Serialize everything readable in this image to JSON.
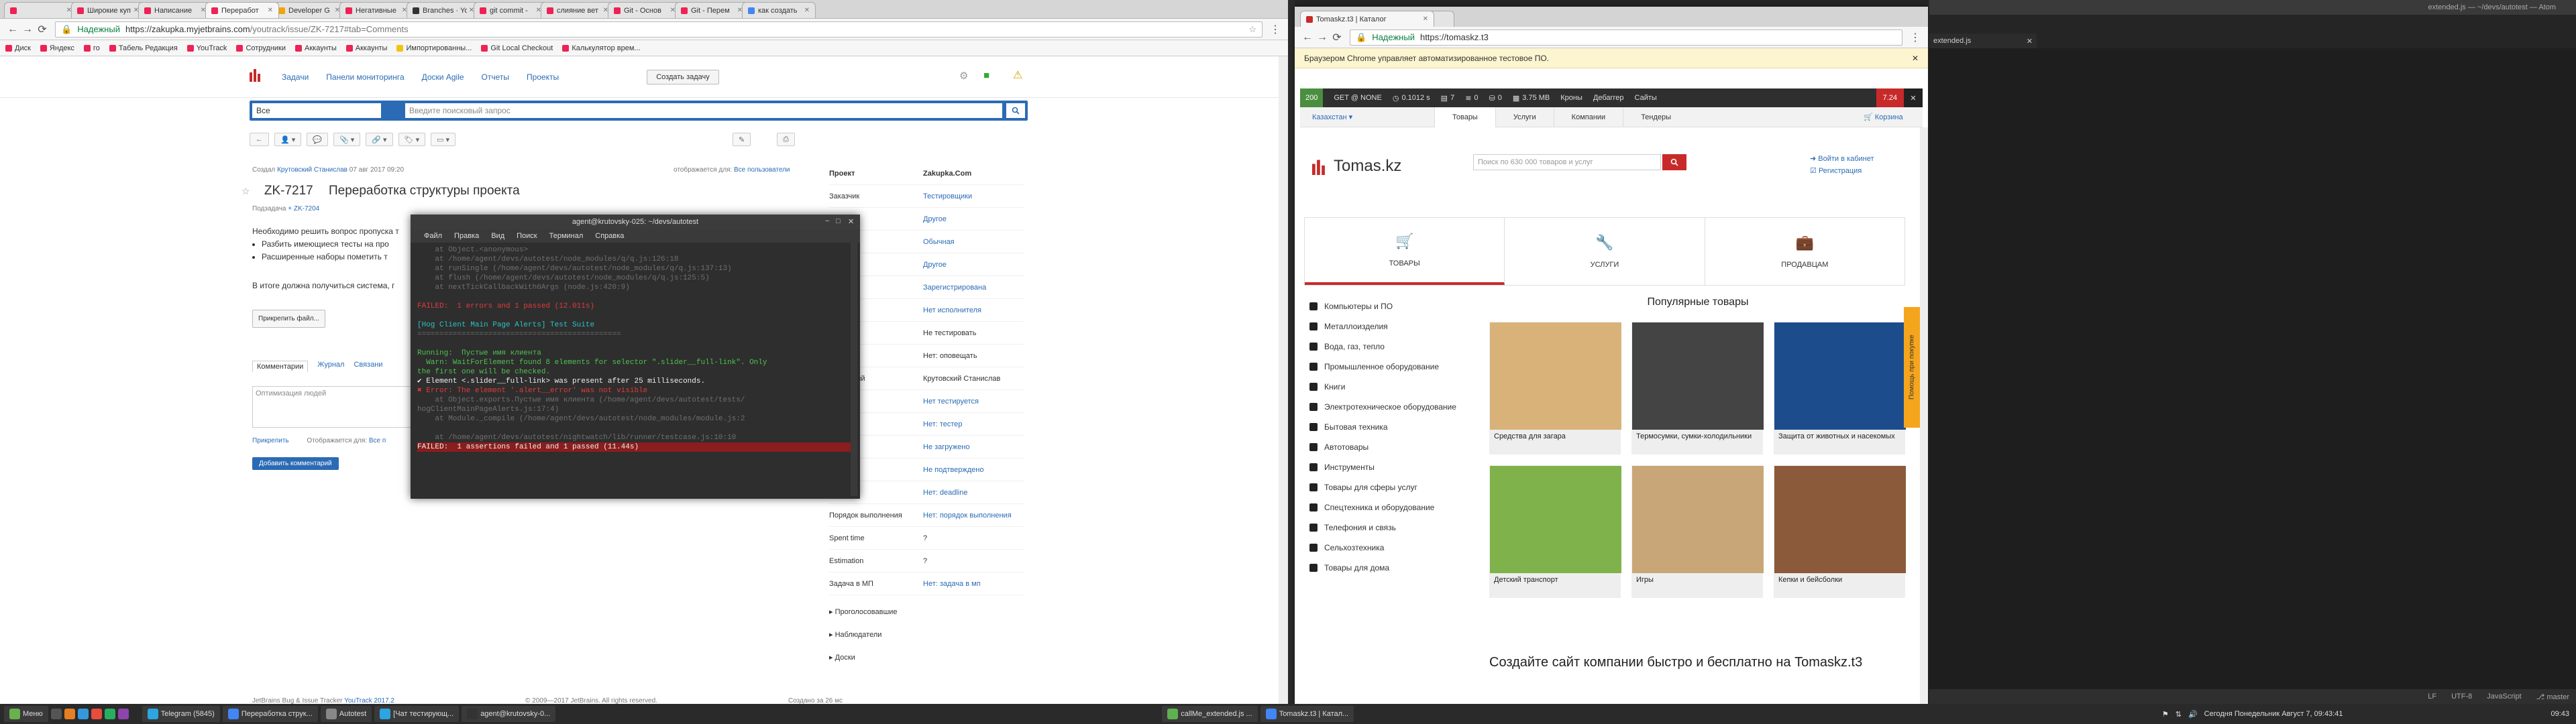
{
  "left_browser": {
    "tabs": [
      {
        "title": "",
        "color": "#e25"
      },
      {
        "title": "Широкие куп",
        "color": "#e25"
      },
      {
        "title": "Написание",
        "color": "#e25"
      },
      {
        "title": "Переработ",
        "color": "#e25"
      },
      {
        "title": "Developer G",
        "color": "#f4a300"
      },
      {
        "title": "Негативные",
        "color": "#e25"
      },
      {
        "title": "Branches · Yo",
        "color": "#333"
      },
      {
        "title": "git commit -",
        "color": "#e25"
      },
      {
        "title": "слияние вет",
        "color": "#e25"
      },
      {
        "title": "Git - Основ",
        "color": "#e25"
      },
      {
        "title": "Git - Перем",
        "color": "#e25"
      },
      {
        "title": "как создать",
        "color": "#4285f4"
      }
    ],
    "secure_label": "Надежный",
    "url_host": "https://zakupka.myjetbrains.com",
    "url_path": "/youtrack/issue/ZK-7217#tab=Comments",
    "bookmarks": [
      "Диск",
      "Яндекс",
      "го",
      "Табель Редакция",
      "YouTrack",
      "Сотрудники",
      "Аккаунты",
      "Аккаунты",
      "Импортированны...",
      "Git Local Checkout",
      "Калькулятор врем..."
    ]
  },
  "youtrack": {
    "nav": [
      "Задачи",
      "Панели мониторинга",
      "Доски Agile",
      "Отчеты",
      "Проекты"
    ],
    "create_label": "Создать задачу",
    "search_scope": "Все",
    "search_placeholder": "Введите поисковый запрос",
    "meta_prefix": "Создал",
    "meta_author": "Крутовский Станислав",
    "meta_date": "07 авг 2017 09:20",
    "meta_visible": "отображается для:",
    "meta_visible_val": "Все пользователи",
    "issue_id": "ZK-7217",
    "issue_title": "Переработка структуры проекта",
    "sub_label": "Подзадача",
    "sub_val": "ZK-7204",
    "body_intro": "Необходимо решить вопрос пропуска т",
    "body_items": [
      "Разбить имеющиеся тесты на про",
      "Расширенные наборы пометить т"
    ],
    "body_result": "В итоге должна получиться система, г",
    "attach_label": "Прикрепить файл...",
    "tab_comments": "Комментарии",
    "tab_journal": "Журнал",
    "tab_links": "Связани",
    "comment_placeholder": "Оптимизация людей",
    "attach_small": "Прикрепить",
    "visible_for": "Отображается для:",
    "visible_for_val": "Все п",
    "post_label": "Добавить комментарий",
    "footer_left": "JetBrains Bug & Issue Tracker",
    "footer_version": "YouTrack 2017.2",
    "footer_mid": "© 2009—2017 JetBrains. All rights reserved.",
    "footer_right": "Создано за 26 мс"
  },
  "sidebar": {
    "header_k": "Проект",
    "header_v": "Zakupka.Com",
    "rows": [
      {
        "k": "Заказчик",
        "v": "Тестировщики"
      },
      {
        "k": "работы",
        "v": "Другое"
      },
      {
        "k": "тет",
        "v": "Обычная"
      },
      {
        "k": "",
        "v": "Другое"
      },
      {
        "k": "ние",
        "v": "Зарегистрирована"
      },
      {
        "k": "итель",
        "v": "Нет исполнителя"
      },
      {
        "k": "вать",
        "v": "Не тестировать"
      },
      {
        "k": "щать",
        "v": "Нет: оповещать"
      },
      {
        "k": "тственный",
        "v": "Крутовский Станислав"
      },
      {
        "k": "рование",
        "v": "Нет тестируется"
      },
      {
        "k": "",
        "v": "Нет: тестер"
      },
      {
        "k": "ено",
        "v": "Не загружено"
      },
      {
        "k": "рждено",
        "v": "Не подтверждено"
      },
      {
        "k": "",
        "v": "Нет: deadline"
      },
      {
        "k": "Порядок выполнения",
        "v": "Нет: порядок выполнения"
      },
      {
        "k": "Spent time",
        "v": "?"
      },
      {
        "k": "Estimation",
        "v": "?"
      },
      {
        "k": "Задача в МП",
        "v": "Нет: задача в мп"
      }
    ],
    "links": [
      "Проголосовавшие",
      "Наблюдатели",
      "Доски"
    ]
  },
  "terminal": {
    "title": "agent@krutovsky-025: ~/devs/autotest",
    "menu": [
      "Файл",
      "Правка",
      "Вид",
      "Поиск",
      "Терминал",
      "Справка"
    ],
    "lines": [
      {
        "t": "    at Object.<anonymous>",
        "c": "t-gray"
      },
      {
        "t": "    at /home/agent/devs/autotest/node_modules/q/q.js:126:18",
        "c": "t-gray"
      },
      {
        "t": "    at runSingle (/home/agent/devs/autotest/node_modules/q/q.js:137:13)",
        "c": "t-gray"
      },
      {
        "t": "    at flush (/home/agent/devs/autotest/node_modules/q/q.js:125:5)",
        "c": "t-gray"
      },
      {
        "t": "    at nextTickCallbackWith0Args (node.js:420:9)",
        "c": "t-gray"
      },
      {
        "t": "",
        "c": ""
      },
      {
        "t": "FAILED:  1 errors and 1 passed (12.011s)",
        "c": "t-red"
      },
      {
        "t": "",
        "c": ""
      },
      {
        "t": "[Hog Client Main Page Alerts] Test Suite",
        "c": "t-cyan"
      },
      {
        "t": "==============================================",
        "c": "t-gray"
      },
      {
        "t": "",
        "c": ""
      },
      {
        "t": "Running:  Пустые имя клиента",
        "c": "t-green"
      },
      {
        "t": "  Warn: WaitForElement found 8 elements for selector \".slider__full-link\". Only",
        "c": "t-green"
      },
      {
        "t": "the first one will be checked.",
        "c": "t-green"
      },
      {
        "t": "✔ Element <.slider__full-link> was present after 25 milliseconds.",
        "c": "t-white"
      },
      {
        "t": "✖ Error: The element '.alert__error' was not visible",
        "c": "t-red"
      },
      {
        "t": "    at Object.exports.Пустые имя клиента (/home/agent/devs/autotest/tests/",
        "c": "t-gray"
      },
      {
        "t": "hogClientMainPageAlerts.js:17:4)",
        "c": "t-gray"
      },
      {
        "t": "    at Module._compile (/home/agent/devs/autotest/node_modules/module.js:2",
        "c": "t-gray"
      },
      {
        "t": "",
        "c": ""
      },
      {
        "t": "    at /home/agent/devs/autotest/nightwatch/lib/runner/testcase.js:10:10",
        "c": "t-gray"
      },
      {
        "t": "FAILED:  1 assertions failed and 1 passed (11.44s)",
        "c": "t-redbg"
      }
    ]
  },
  "right_browser": {
    "tabs": [
      {
        "title": "Tomaskz.t3 | Каталог",
        "color": "#c82a2a"
      },
      {
        "title": "",
        "color": "#ccc"
      }
    ],
    "secure_label": "Надежный",
    "url": "https://tomaskz.t3",
    "info_text": "Браузером Chrome управляет автоматизированное тестовое ПО.",
    "debug": {
      "status": "200",
      "method": "GET @ NONE",
      "time": "0.1012 s",
      "num1": "7",
      "num2": "0",
      "num3": "0",
      "mem": "3.75 MB",
      "links": [
        "Кроны",
        "Дебаггер",
        "Сайты"
      ],
      "version": "7.24"
    },
    "city": "Казахстан",
    "nav": [
      "Товары",
      "Услуги",
      "Компании",
      "Тендеры"
    ],
    "cart": "Корзина",
    "logo": "Tomas.kz",
    "search_placeholder": "Поиск по 630 000 товаров и услуг",
    "login": "Войти в кабинет",
    "register": "Регистрация",
    "cats": [
      "ТОВАРЫ",
      "УСЛУГИ",
      "ПРОДАВЦАМ"
    ],
    "menu": [
      "Компьютеры и ПО",
      "Металлоизделия",
      "Вода, газ, тепло",
      "Промышленное оборудование",
      "Книги",
      "Электротехническое оборудование",
      "Бытовая техника",
      "Автотовары",
      "Инструменты",
      "Товары для сферы услуг",
      "Спецтехника и оборудование",
      "Телефония и связь",
      "Сельхозтехника",
      "Товары для дома"
    ],
    "popular_title": "Популярные товары",
    "products": [
      {
        "name": "Средства для загара",
        "color": "#d9b27a"
      },
      {
        "name": "Термосумки, сумки-холодильники",
        "color": "#444"
      },
      {
        "name": "Защита от животных и насекомых",
        "color": "#1c4c8c"
      },
      {
        "name": "Детский транспорт",
        "color": "#7fb24a"
      },
      {
        "name": "Игры",
        "color": "#c9a678"
      },
      {
        "name": "Кепки и бейсболки",
        "color": "#8a5a3a"
      }
    ],
    "promo": "Создайте сайт компании быстро и бесплатно на Tomaskz.t3",
    "sidetab": "Помощь при покупке"
  },
  "atom": {
    "title": "extended.js — ~/devs/autotest — Atom",
    "tab": "extended.js",
    "status": [
      "LF",
      "UTF-8",
      "JavaScript",
      "master"
    ]
  },
  "taskbar": {
    "menu": "Меню",
    "tasks": [
      "Telegram (5845)",
      "Переработка струк...",
      "Autotest",
      "[Чат тестирующ...",
      "agent@krutovsky-0...",
      "callMe_extended.js ...",
      "Tomaskz.t3 | Катал..."
    ],
    "clock": "Сегодня Понедельник Август 7, 09:43:41",
    "clock2": "09:43"
  }
}
